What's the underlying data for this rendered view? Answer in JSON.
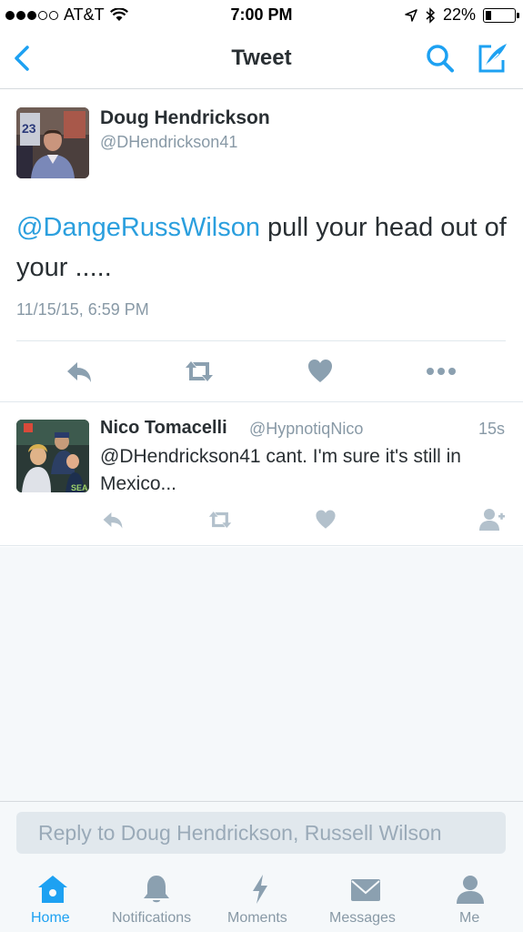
{
  "status_bar": {
    "carrier": "AT&T",
    "time": "7:00 PM",
    "battery": "22%",
    "battery_level": 0.22
  },
  "nav": {
    "title": "Tweet",
    "back_icon": "chevron-left-icon",
    "search_icon": "search-icon",
    "compose_icon": "compose-icon"
  },
  "main_tweet": {
    "author_name": "Doug Hendrickson",
    "author_handle": "@DHendrickson41",
    "mention": "@DangeRussWilson",
    "text": " pull your head out of your .....",
    "timestamp": "11/15/15, 6:59 PM",
    "actions": [
      "reply-icon",
      "retweet-icon",
      "like-icon",
      "more-icon"
    ]
  },
  "reply_tweet": {
    "author_name": "Nico Tomacelli",
    "author_handle": "@HypnotiqNico",
    "age": "15s",
    "text": "@DHendrickson41 cant. I'm sure it's still in Mexico...",
    "actions": [
      "reply-icon",
      "retweet-icon",
      "like-icon",
      "follow-icon"
    ]
  },
  "composer": {
    "placeholder": "Reply to Doug Hendrickson, Russell Wilson"
  },
  "tabs": [
    {
      "label": "Home",
      "icon": "home-icon",
      "active": true
    },
    {
      "label": "Notifications",
      "icon": "bell-icon",
      "active": false
    },
    {
      "label": "Moments",
      "icon": "lightning-icon",
      "active": false
    },
    {
      "label": "Messages",
      "icon": "envelope-icon",
      "active": false
    },
    {
      "label": "Me",
      "icon": "person-icon",
      "active": false
    }
  ],
  "colors": {
    "accent": "#1da1f2",
    "link": "#2b9fde",
    "muted": "#8899a6",
    "icon": "#8ba0b0"
  }
}
